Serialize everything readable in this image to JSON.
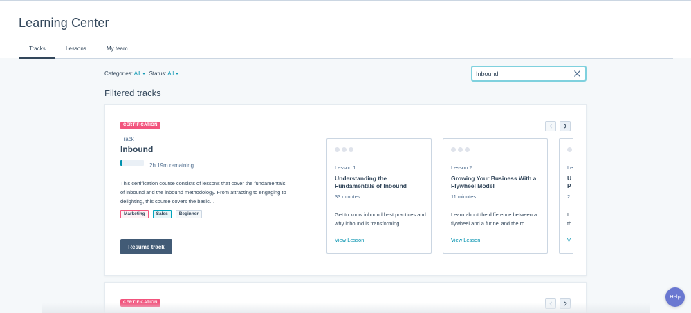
{
  "header": {
    "title": "Learning Center",
    "tabs": [
      {
        "label": "Tracks",
        "active": true
      },
      {
        "label": "Lessons",
        "active": false
      },
      {
        "label": "My team",
        "active": false
      }
    ]
  },
  "filters": {
    "categories": {
      "label": "Categories:",
      "value": "All"
    },
    "status": {
      "label": "Status:",
      "value": "All"
    }
  },
  "search": {
    "value": "Inbound",
    "clear_icon": "close-icon"
  },
  "section_title": "Filtered tracks",
  "colors": {
    "accent": "#0091ae",
    "badge": "#f2547d",
    "primary_button": "#425b76",
    "search_focus": "#7fd1de"
  },
  "tracks": [
    {
      "badge": "CERTIFICATION",
      "kicker": "Track",
      "name": "Inbound",
      "progress": 0.05,
      "remaining": "2h 19m remaining",
      "description": "This certification course consists of lessons that cover the fundamentals of inbound and the inbound methodology. From attracting to engaging to delighting, this course covers the basic…",
      "tags": [
        "Marketing",
        "Sales",
        "Beginner"
      ],
      "resume_label": "Resume track",
      "lessons": [
        {
          "number": "Lesson 1",
          "title": "Understanding the Fundamentals of Inbound",
          "duration": "33 minutes",
          "description": "Get to know inbound best practices and why inbound is transforming…",
          "link": "View Lesson"
        },
        {
          "number": "Lesson 2",
          "title": "Growing Your Business With a Flywheel Model",
          "duration": "11 minutes",
          "description": "Learn about the difference between a flywheel and a funnel and the ro…",
          "link": "View Lesson"
        },
        {
          "number": "Le",
          "title": "U P",
          "duration": "2",
          "description": "L th",
          "link": "V"
        }
      ]
    },
    {
      "badge": "CERTIFICATION"
    }
  ],
  "help": {
    "label": "Help"
  }
}
